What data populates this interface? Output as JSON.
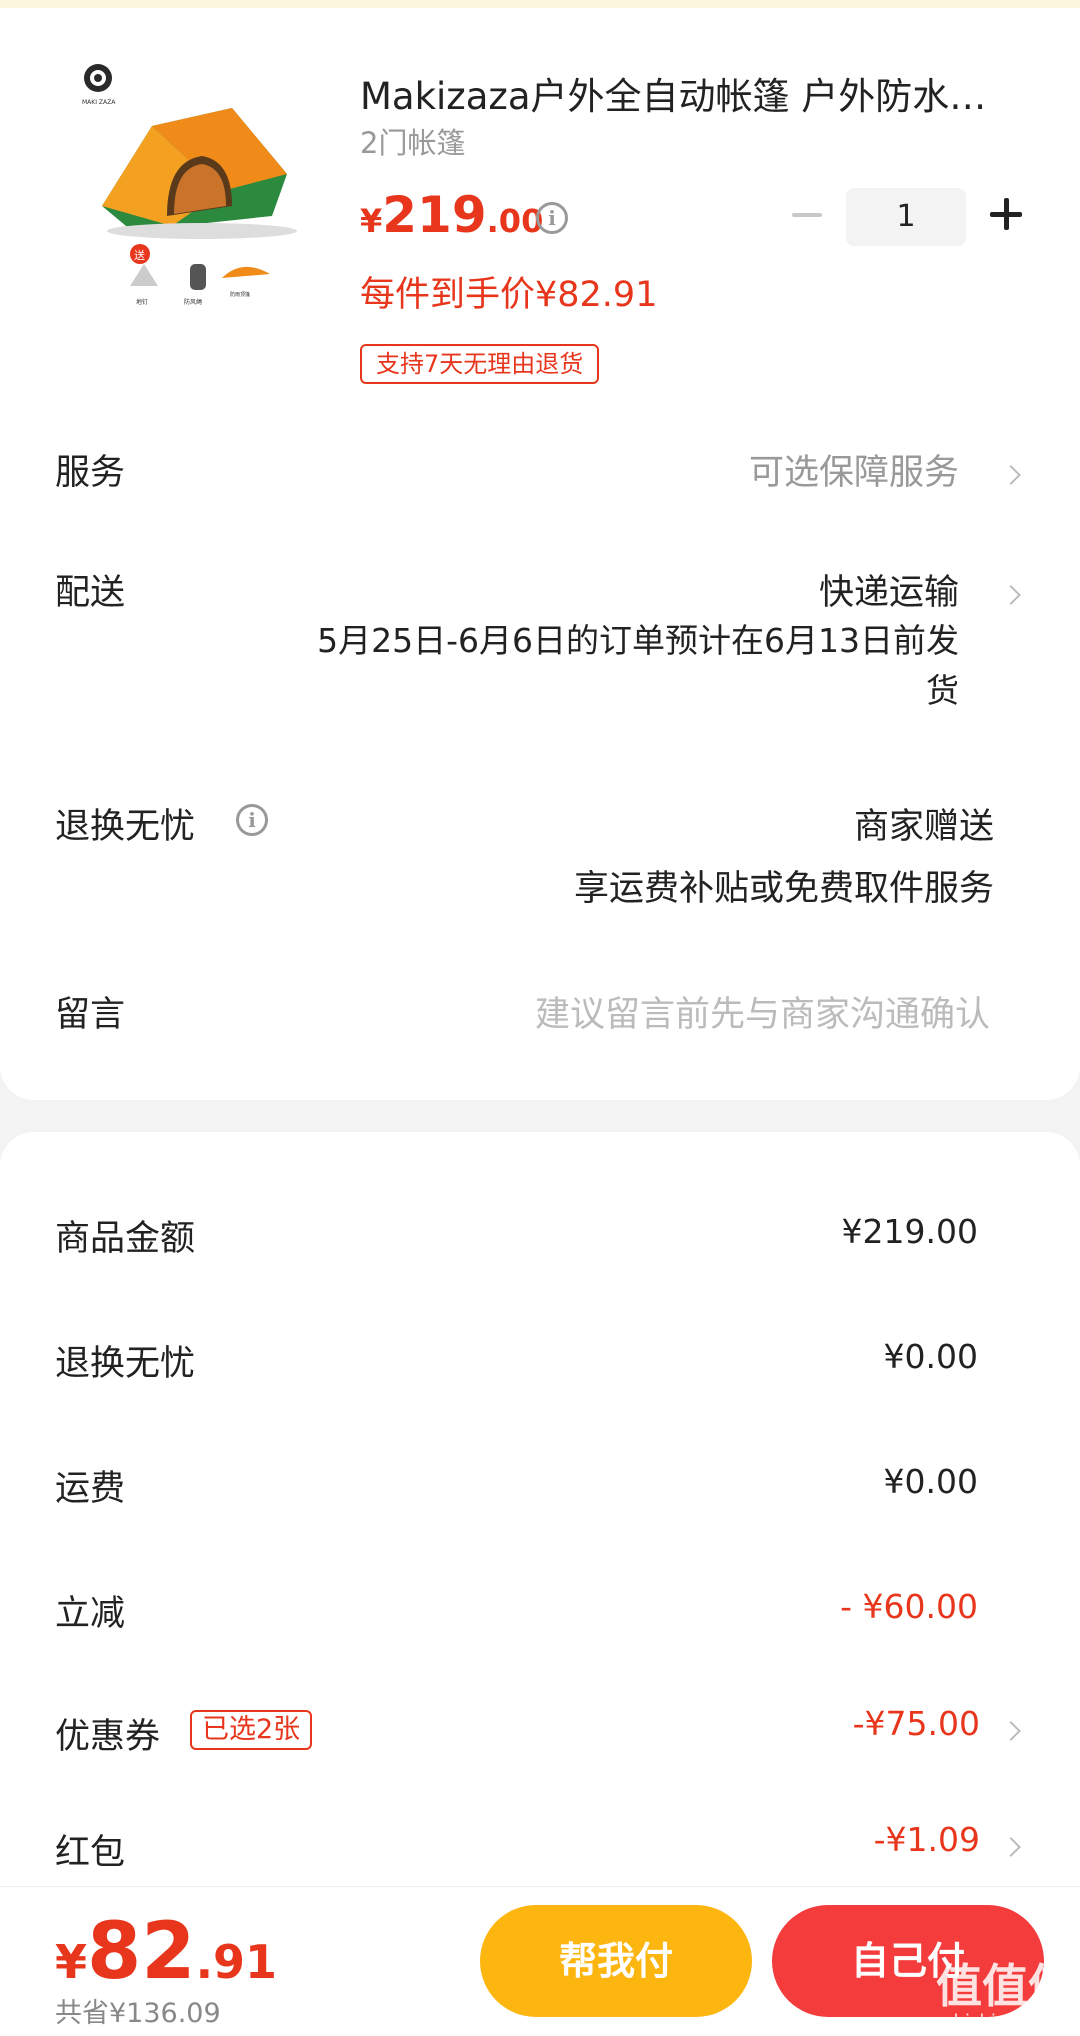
{
  "product": {
    "title": "Makizaza户外全自动帐篷 户外防水帐篷",
    "spec": "2门帐篷",
    "price": {
      "currency": "¥",
      "integer": "219",
      "decimal": ".00"
    },
    "unit_price": "每件到手价¥82.91",
    "badge": "支持7天无理由退货",
    "quantity": "1",
    "thumbnail": {
      "brand_logo": "MAKI ZAZA",
      "gift_tag": "送",
      "accessories": [
        "地钉",
        "防风绳",
        "防雨顶篷"
      ]
    }
  },
  "rows": {
    "service": {
      "label": "服务",
      "value": "可选保障服务"
    },
    "delivery": {
      "label": "配送",
      "value": "快递运输",
      "note_line1": "5月25日-6月6日的订单预计在6月13日前发",
      "note_line2": "货"
    },
    "returns": {
      "label": "退换无忧",
      "value": "商家赠送",
      "note": "享运费补贴或免费取件服务"
    },
    "message": {
      "label": "留言",
      "placeholder": "建议留言前先与商家沟通确认"
    }
  },
  "summary": {
    "goods": {
      "label": "商品金额",
      "value": "¥219.00"
    },
    "returns": {
      "label": "退换无忧",
      "value": "¥0.00"
    },
    "shipping": {
      "label": "运费",
      "value": "¥0.00"
    },
    "discount": {
      "label": "立减",
      "value": "- ¥60.00"
    },
    "coupon": {
      "label": "优惠券",
      "tag": "已选2张",
      "value": "-¥75.00"
    },
    "redpacket": {
      "label": "红包",
      "value": "-¥1.09"
    }
  },
  "bottom": {
    "total": {
      "currency": "¥",
      "integer": "82",
      "decimal": ".91"
    },
    "saved": "共省¥136.09",
    "help_pay": "帮我付",
    "self_pay": "自己付"
  },
  "watermark": {
    "glyphs": "值值值",
    "site": "zhizhizhi.com"
  },
  "colors": {
    "accent_red": "#e8361d",
    "help_button": "#fdb510",
    "self_button": "#f43c3c"
  }
}
